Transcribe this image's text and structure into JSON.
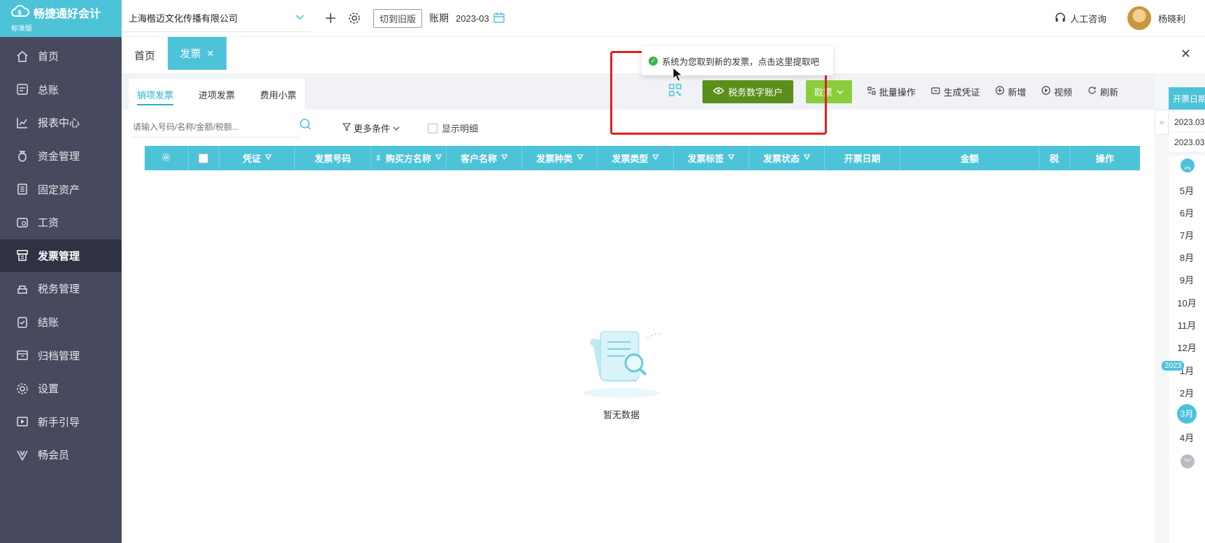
{
  "brand": {
    "name": "畅捷通好会计",
    "edition": "标准版"
  },
  "sidebar": {
    "items": [
      {
        "label": "首页",
        "icon": "home-icon"
      },
      {
        "label": "总账",
        "icon": "ledger-icon"
      },
      {
        "label": "报表中心",
        "icon": "chart-icon"
      },
      {
        "label": "资金管理",
        "icon": "money-bag-icon"
      },
      {
        "label": "固定资产",
        "icon": "asset-icon"
      },
      {
        "label": "工资",
        "icon": "salary-icon"
      },
      {
        "label": "发票管理",
        "icon": "invoice-icon"
      },
      {
        "label": "税务管理",
        "icon": "tax-icon"
      },
      {
        "label": "结账",
        "icon": "checkout-icon"
      },
      {
        "label": "归档管理",
        "icon": "archive-icon"
      },
      {
        "label": "设置",
        "icon": "gear-icon"
      },
      {
        "label": "新手引导",
        "icon": "guide-icon"
      },
      {
        "label": "畅会员",
        "icon": "vip-icon"
      }
    ],
    "active_index": 6
  },
  "topbar": {
    "company": "上海楷迈文化传播有限公司",
    "switch_label": "切到旧版",
    "period_label": "账期",
    "period_value": "2023-03",
    "consult_label": "人工咨询",
    "user_name": "杨晓利"
  },
  "tabs": {
    "home": "首页",
    "invoice": "发票"
  },
  "subtabs": [
    "销项发票",
    "进项发票",
    "费用小票"
  ],
  "toolbar": {
    "tax_account": "税务数字账户",
    "fetch": "取票",
    "batch": "批量操作",
    "voucher": "生成凭证",
    "add": "新增",
    "video": "视频",
    "refresh": "刷新"
  },
  "search": {
    "placeholder": "请输入号码/名称/金额/税额...",
    "more_filter": "更多条件",
    "show_detail": "显示明细"
  },
  "table": {
    "columns": [
      "凭证",
      "发票号码",
      "购买方名称",
      "客户名称",
      "发票种类",
      "发票类型",
      "发票标签",
      "发票状态",
      "开票日期",
      "金额",
      "税",
      "操作"
    ]
  },
  "empty_text": "暂无数据",
  "notice": "系统为您取到新的发票，点击这里提取吧",
  "right_panel": {
    "header": "开票日期",
    "dates": [
      "2023.03",
      "2023.03"
    ],
    "year": "2023",
    "months": [
      "5月",
      "6月",
      "7月",
      "8月",
      "9月",
      "10月",
      "11月",
      "12月",
      "1月",
      "2月",
      "3月",
      "4月"
    ],
    "active_month": "3月"
  },
  "colors": {
    "accent": "#4dc3d8",
    "sidebar": "#474a5e",
    "tax_button": "#5b8f1c",
    "fetch_button": "#8acd3a",
    "highlight": "#e02020"
  }
}
